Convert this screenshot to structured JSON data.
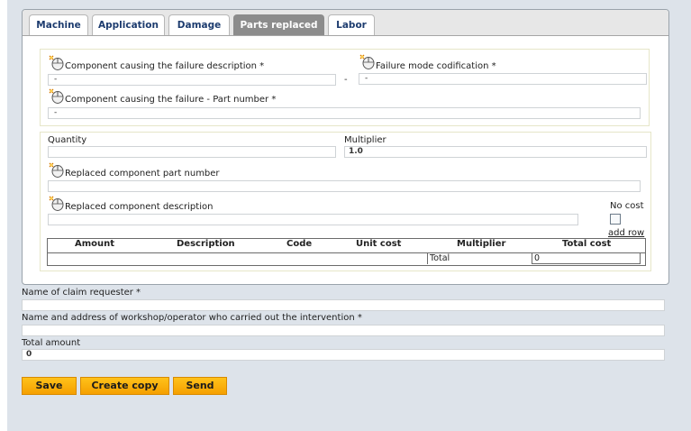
{
  "tabs": [
    {
      "label": "Machine",
      "active": false
    },
    {
      "label": "Application",
      "active": false
    },
    {
      "label": "Damage",
      "active": false
    },
    {
      "label": "Parts replaced",
      "active": true
    },
    {
      "label": "Labor",
      "active": false
    }
  ],
  "failure": {
    "component_desc_label": "Component causing the failure description *",
    "component_desc_value": "-",
    "separator": "-",
    "failure_mode_label": "Failure mode codification *",
    "failure_mode_value": "-",
    "part_number_label": "Component causing the failure - Part number *",
    "part_number_value": "-"
  },
  "parts": {
    "quantity_label": "Quantity",
    "quantity_value": "",
    "multiplier_label": "Multiplier",
    "multiplier_value": "1.0",
    "replaced_pn_label": "Replaced component part number",
    "replaced_pn_value": "",
    "replaced_desc_label": "Replaced component description",
    "replaced_desc_value": "",
    "no_cost_label": "No cost",
    "add_row_label": "add row"
  },
  "table": {
    "headers": [
      "Amount",
      "Description",
      "Code",
      "Unit cost",
      "Multiplier",
      "Total cost"
    ],
    "total_label": "Total",
    "total_value": "0"
  },
  "claim": {
    "requester_label": "Name of claim requester *",
    "requester_value": "",
    "workshop_label": "Name and address of workshop/operator who carried out the intervention *",
    "workshop_value": "",
    "total_amount_label": "Total amount",
    "total_amount_value": "0"
  },
  "buttons": {
    "save": "Save",
    "create_copy": "Create copy",
    "send": "Send"
  },
  "icons": {
    "help": "help-mouse-icon"
  },
  "colors": {
    "accent_button": "#ffb300",
    "tab_text": "#1d3c6f",
    "active_tab": "#8c8c8c"
  }
}
